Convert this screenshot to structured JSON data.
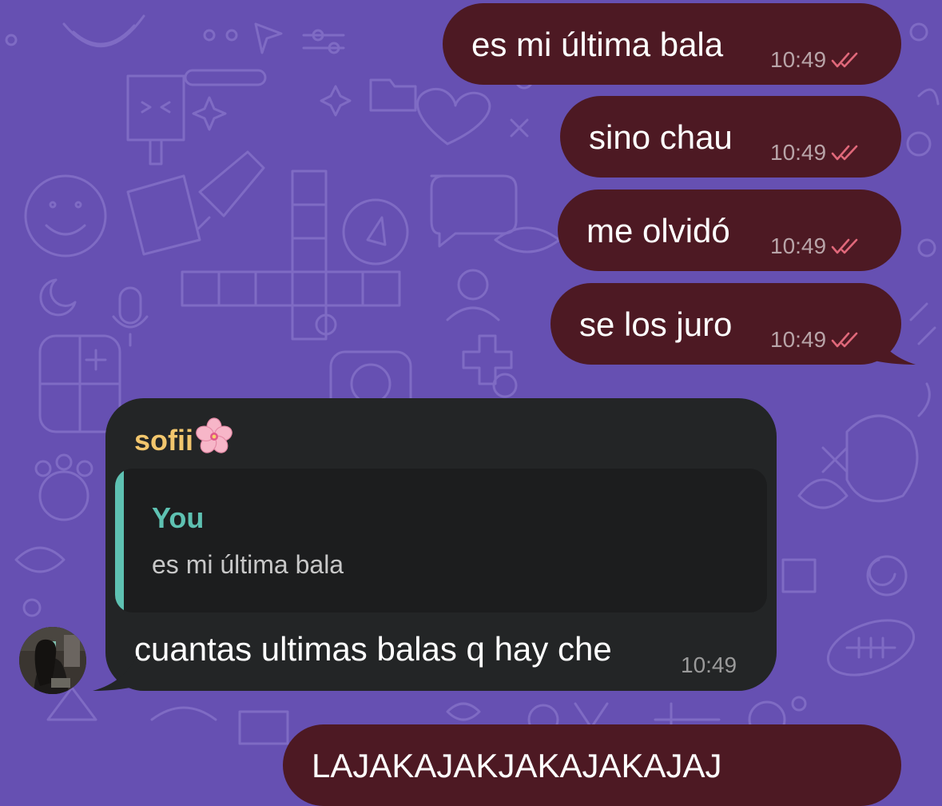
{
  "chat": {
    "outgoing_messages": [
      {
        "text": "es mi última bala",
        "time": "10:49",
        "status": "read"
      },
      {
        "text": "sino chau",
        "time": "10:49",
        "status": "read"
      },
      {
        "text": "me olvidó",
        "time": "10:49",
        "status": "read"
      },
      {
        "text": "se los juro",
        "time": "10:49",
        "status": "read"
      }
    ],
    "incoming_message": {
      "sender": "sofii",
      "sender_emoji": "cherry-blossom-icon",
      "reply": {
        "author": "You",
        "text": "es mi última bala"
      },
      "text": "cuantas ultimas balas q hay che",
      "time": "10:49"
    },
    "partial_message": {
      "text": "LAJAKAJAKJAKAJAKAJAJ"
    }
  },
  "colors": {
    "background": "#6650b2",
    "outgoing_bubble": "#4d1923",
    "incoming_bubble": "#232526",
    "sender_name": "#f2c66d",
    "reply_accent": "#5ec1b2",
    "read_ticks": "#e0687a"
  }
}
